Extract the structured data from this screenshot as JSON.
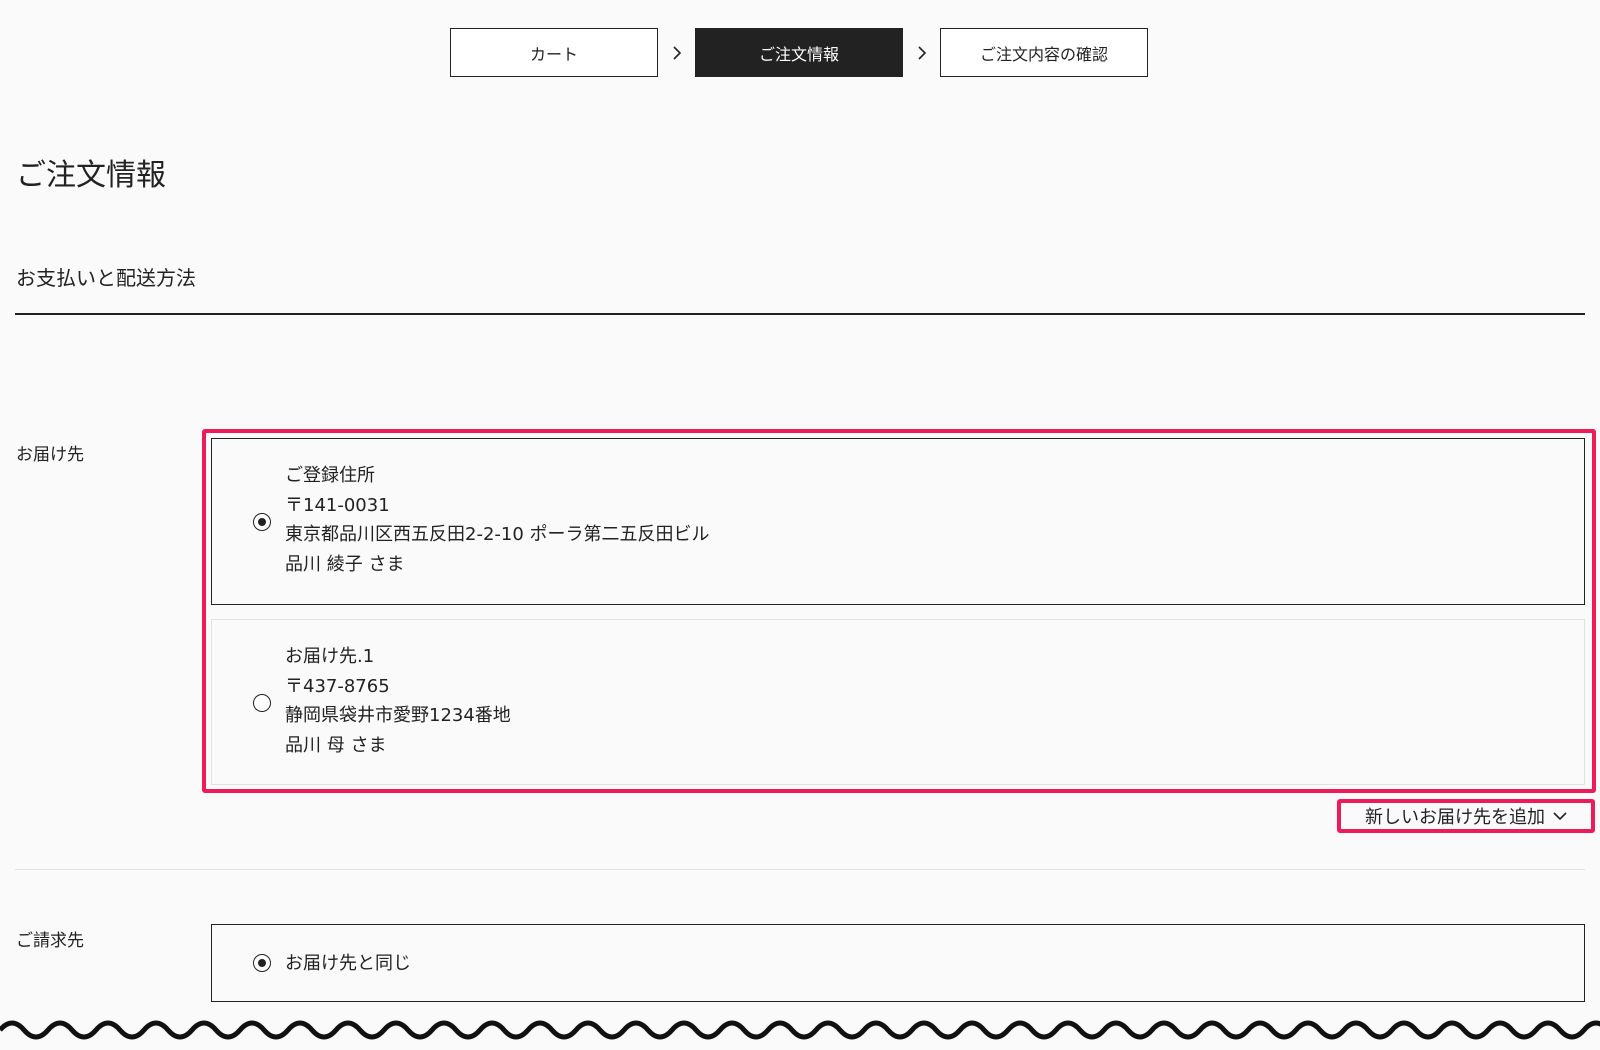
{
  "stepper": {
    "steps": [
      "カート",
      "ご注文情報",
      "ご注文内容の確認"
    ],
    "active_index": 1
  },
  "page_title": "ご注文情報",
  "section_title": "お支払いと配送方法",
  "delivery": {
    "label": "お届け先",
    "options": [
      {
        "name": "ご登録住所",
        "postal": "〒141-0031",
        "address": "東京都品川区西五反田2-2-10 ポーラ第二五反田ビル",
        "recipient": "品川 綾子 さま",
        "selected": true
      },
      {
        "name": "お届け先.1",
        "postal": "〒437-8765",
        "address": "静岡県袋井市愛野1234番地",
        "recipient": "品川 母 さま",
        "selected": false
      }
    ],
    "add_new_label": "新しいお届け先を追加"
  },
  "billing": {
    "label": "ご請求先",
    "option_label": "お届け先と同じ",
    "selected": true
  },
  "colors": {
    "highlight": "#ee1b5b",
    "text": "#222222",
    "background": "#fafafa"
  },
  "icons": [
    "chevron-right-icon",
    "chevron-down-icon",
    "radio-checked-icon",
    "radio-unchecked-icon"
  ]
}
